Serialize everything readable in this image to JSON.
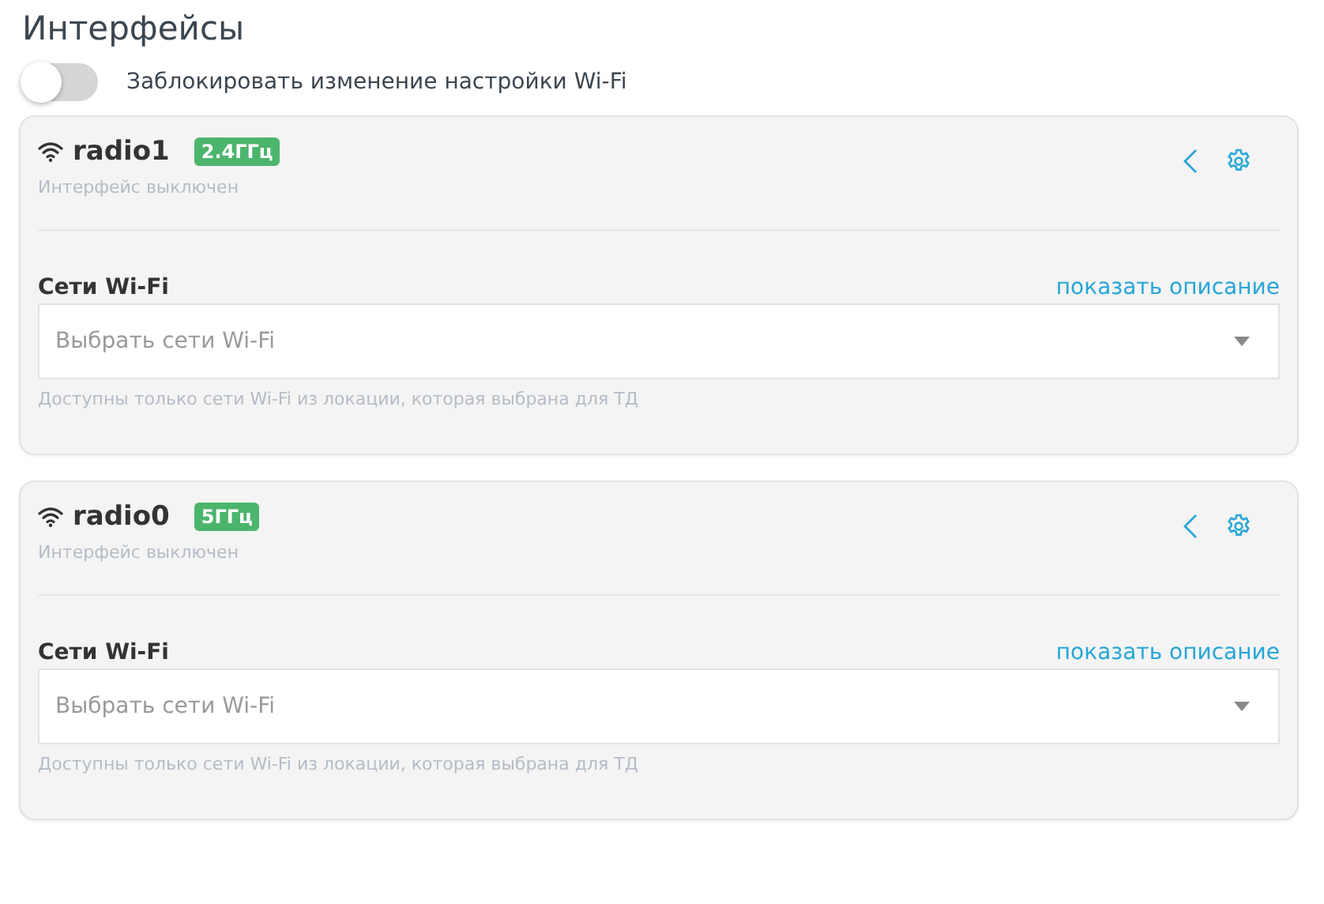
{
  "title": "Интерфейсы",
  "lock_toggle": {
    "label": "Заблокировать изменение настройки Wi-Fi",
    "on": false
  },
  "interfaces": [
    {
      "name": "radio1",
      "band": "2.4ГГц",
      "status": "Интерфейс выключен",
      "networks_label": "Сети Wi-Fi",
      "description_link": "показать описание",
      "networks_select": {
        "placeholder": "Выбрать сети Wi-Fi"
      },
      "hint": "Доступны только сети Wi-Fi из локации, которая выбрана для ТД"
    },
    {
      "name": "radio0",
      "band": "5ГГц",
      "status": "Интерфейс выключен",
      "networks_label": "Сети Wi-Fi",
      "description_link": "показать описание",
      "networks_select": {
        "placeholder": "Выбрать сети Wi-Fi"
      },
      "hint": "Доступны только сети Wi-Fi из локации, которая выбрана для ТД"
    }
  ]
}
